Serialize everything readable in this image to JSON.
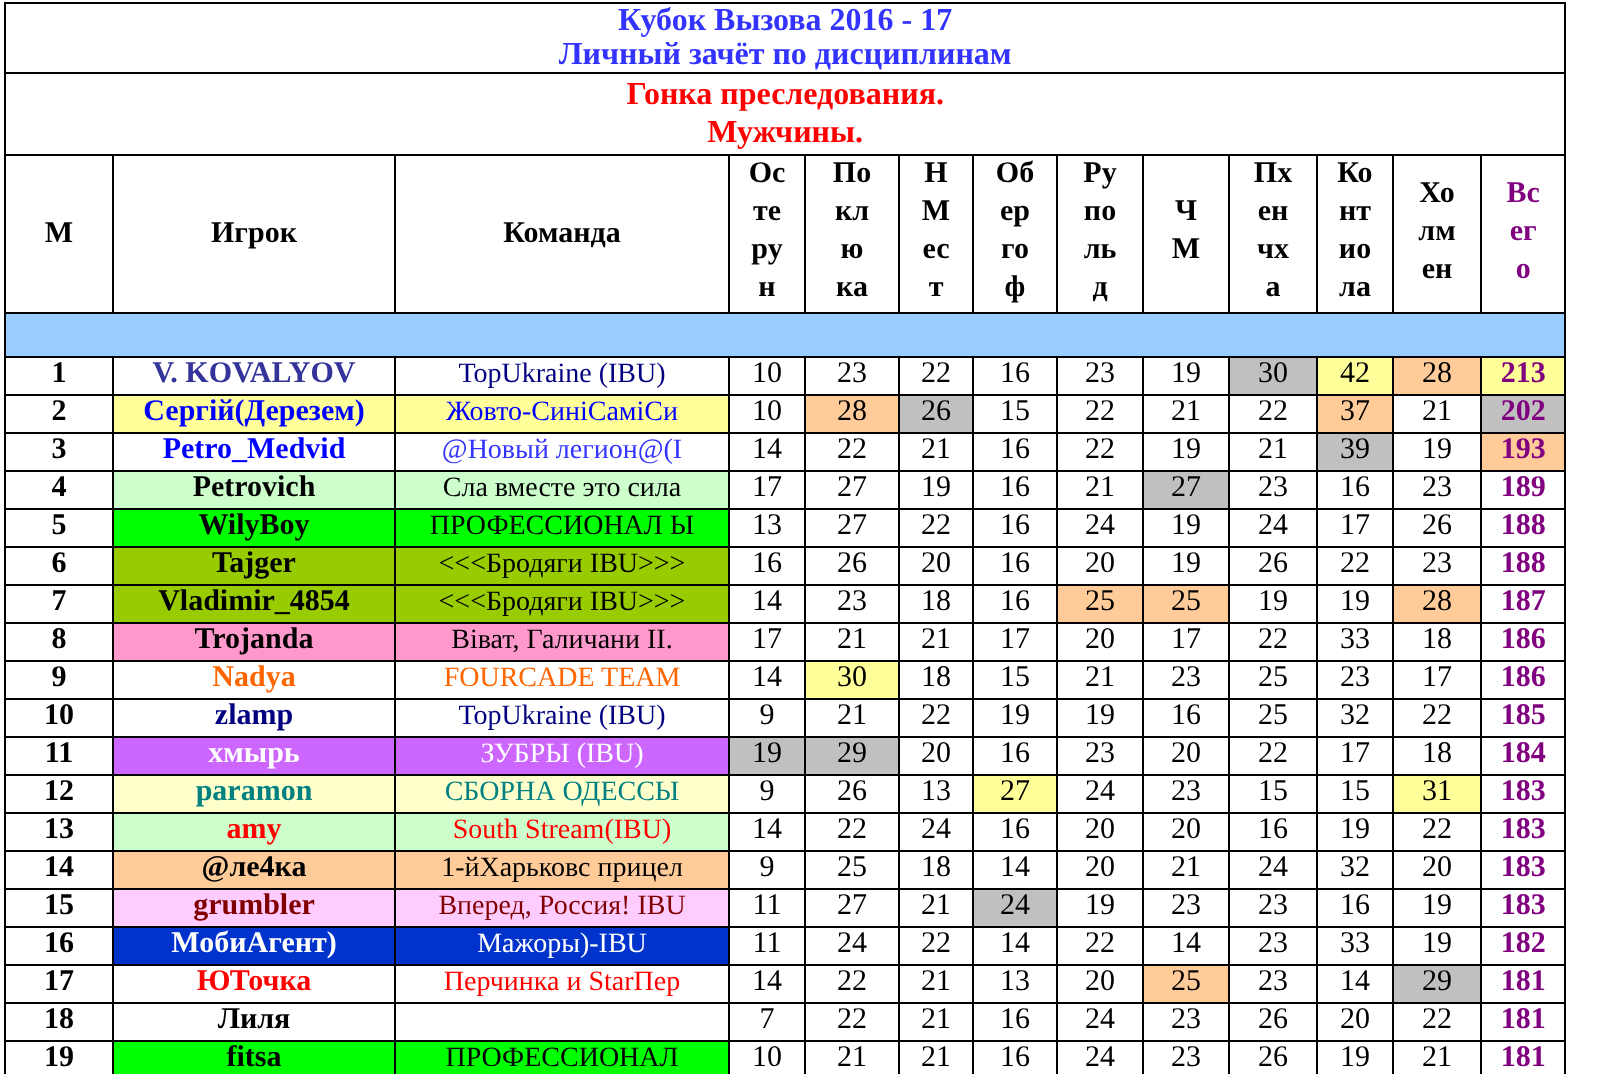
{
  "title": "Кубок Вызова 2016 - 17",
  "subtitle": "Личный зачёт по дисциплинам",
  "discipline": "Гонка преследования.",
  "category": "Мужчины.",
  "columns": [
    {
      "label": "М",
      "kind": "narrow"
    },
    {
      "label": "Игрок",
      "kind": "wide"
    },
    {
      "label": "Команда",
      "kind": "wide"
    },
    {
      "label": "Остерун",
      "kind": "score"
    },
    {
      "label": "Поклюка",
      "kind": "score"
    },
    {
      "label": "НМест",
      "kind": "score"
    },
    {
      "label": "Обергоф",
      "kind": "score"
    },
    {
      "label": "Рупольд",
      "kind": "score"
    },
    {
      "label": "ЧМ",
      "kind": "score"
    },
    {
      "label": "Пхенчха",
      "kind": "score"
    },
    {
      "label": "Контиола",
      "kind": "score"
    },
    {
      "label": "Холмен",
      "kind": "score"
    },
    {
      "label": "Всего",
      "kind": "total"
    }
  ],
  "rows": [
    {
      "place": "1",
      "player": {
        "name": "V. KOVALYOV",
        "color": "#333399"
      },
      "team": {
        "name": "TopUkraine (IBU)",
        "color": "#000080"
      },
      "scores": [
        {
          "value": "10"
        },
        {
          "value": "23"
        },
        {
          "value": "22"
        },
        {
          "value": "16"
        },
        {
          "value": "23"
        },
        {
          "value": "19"
        },
        {
          "value": "30",
          "color": "#c0c0c0"
        },
        {
          "value": "42",
          "color": "#ffff99"
        },
        {
          "value": "28",
          "color": "#ffcc99"
        }
      ],
      "total": {
        "value": "213",
        "color": "#ffff99"
      }
    },
    {
      "place": "2",
      "player": {
        "name": "Сергій(Дерезем)",
        "color": "#0000ff",
        "background": {
          "color": "#ffff99"
        }
      },
      "team": {
        "name": "Жовто-СиніСаміСи",
        "color": "#0000ff",
        "background": {
          "color": "#ffff99"
        }
      },
      "scores": [
        {
          "value": "10"
        },
        {
          "value": "28",
          "color": "#ffcc99"
        },
        {
          "value": "26",
          "color": "#c0c0c0"
        },
        {
          "value": "15"
        },
        {
          "value": "22"
        },
        {
          "value": "21"
        },
        {
          "value": "22"
        },
        {
          "value": "37",
          "color": "#ffcc99"
        },
        {
          "value": "21"
        }
      ],
      "total": {
        "value": "202",
        "color": "#c0c0c0"
      }
    },
    {
      "place": "3",
      "player": {
        "name": "Petro_Medvid",
        "color": "#0000ff"
      },
      "team": {
        "name": "@Новый легион@(I",
        "color": "#3333ff"
      },
      "scores": [
        {
          "value": "14"
        },
        {
          "value": "22"
        },
        {
          "value": "21"
        },
        {
          "value": "16"
        },
        {
          "value": "22"
        },
        {
          "value": "19"
        },
        {
          "value": "21"
        },
        {
          "value": "39",
          "color": "#c0c0c0"
        },
        {
          "value": "19"
        }
      ],
      "total": {
        "value": "193",
        "color": "#ffcc99"
      }
    },
    {
      "place": "4",
      "player": {
        "name": "Petrovich",
        "color": "#000000",
        "background": {
          "color": "#ccffcc"
        }
      },
      "team": {
        "name": "Сла вместе это сила",
        "color": "#000000",
        "background": {
          "color": "#ccffcc"
        }
      },
      "scores": [
        {
          "value": "17"
        },
        {
          "value": "27"
        },
        {
          "value": "19"
        },
        {
          "value": "16"
        },
        {
          "value": "21"
        },
        {
          "value": "27",
          "color": "#c0c0c0"
        },
        {
          "value": "23"
        },
        {
          "value": "16"
        },
        {
          "value": "23"
        }
      ],
      "total": {
        "value": "189"
      }
    },
    {
      "place": "5",
      "player": {
        "name": "WilyBoy",
        "color": "#000000",
        "background": {
          "color": "#00ff00"
        }
      },
      "team": {
        "name": "ПРОФЕССИОНАЛ Ы",
        "color": "#000000",
        "background": {
          "color": "#00ff00"
        }
      },
      "scores": [
        {
          "value": "13"
        },
        {
          "value": "27"
        },
        {
          "value": "22"
        },
        {
          "value": "16"
        },
        {
          "value": "24"
        },
        {
          "value": "19"
        },
        {
          "value": "24"
        },
        {
          "value": "17"
        },
        {
          "value": "26"
        }
      ],
      "total": {
        "value": "188"
      }
    },
    {
      "place": "6",
      "player": {
        "name": "Tajger",
        "color": "#000000",
        "background": {
          "color": "#99cc00"
        }
      },
      "team": {
        "name": "<<<Бродяги IBU>>>",
        "color": "#000000",
        "background": {
          "color": "#99cc00"
        }
      },
      "scores": [
        {
          "value": "16"
        },
        {
          "value": "26"
        },
        {
          "value": "20"
        },
        {
          "value": "16"
        },
        {
          "value": "20"
        },
        {
          "value": "19"
        },
        {
          "value": "26"
        },
        {
          "value": "22"
        },
        {
          "value": "23"
        }
      ],
      "total": {
        "value": "188"
      }
    },
    {
      "place": "7",
      "player": {
        "name": "Vladimir_4854",
        "color": "#000000",
        "background": {
          "color": "#99cc00"
        }
      },
      "team": {
        "name": "<<<Бродяги IBU>>>",
        "color": "#000000",
        "background": {
          "color": "#99cc00"
        }
      },
      "scores": [
        {
          "value": "14"
        },
        {
          "value": "23"
        },
        {
          "value": "18"
        },
        {
          "value": "16"
        },
        {
          "value": "25",
          "color": "#ffcc99"
        },
        {
          "value": "25",
          "color": "#ffcc99"
        },
        {
          "value": "19"
        },
        {
          "value": "19"
        },
        {
          "value": "28",
          "color": "#ffcc99"
        }
      ],
      "total": {
        "value": "187"
      }
    },
    {
      "place": "8",
      "player": {
        "name": "Trojanda",
        "color": "#000000",
        "background": {
          "color": "#ff99cc"
        }
      },
      "team": {
        "name": "Віват, Галичани II.",
        "color": "#000000",
        "background": {
          "color": "#ff99cc"
        }
      },
      "scores": [
        {
          "value": "17"
        },
        {
          "value": "21"
        },
        {
          "value": "21"
        },
        {
          "value": "17"
        },
        {
          "value": "20"
        },
        {
          "value": "17"
        },
        {
          "value": "22"
        },
        {
          "value": "33"
        },
        {
          "value": "18"
        }
      ],
      "total": {
        "value": "186"
      }
    },
    {
      "place": "9",
      "player": {
        "name": "Nadya",
        "color": "#ff6600"
      },
      "team": {
        "name": "FOURCADE  TEAM",
        "color": "#ff6600"
      },
      "scores": [
        {
          "value": "14"
        },
        {
          "value": "30",
          "color": "#ffff99"
        },
        {
          "value": "18"
        },
        {
          "value": "15"
        },
        {
          "value": "21"
        },
        {
          "value": "23"
        },
        {
          "value": "25"
        },
        {
          "value": "23"
        },
        {
          "value": "17"
        }
      ],
      "total": {
        "value": "186"
      }
    },
    {
      "place": "10",
      "player": {
        "name": "zlamp",
        "color": "#000080"
      },
      "team": {
        "name": "TopUkraine (IBU)",
        "color": "#000080"
      },
      "scores": [
        {
          "value": "9"
        },
        {
          "value": "21"
        },
        {
          "value": "22"
        },
        {
          "value": "19"
        },
        {
          "value": "19"
        },
        {
          "value": "16"
        },
        {
          "value": "25"
        },
        {
          "value": "32"
        },
        {
          "value": "22"
        }
      ],
      "total": {
        "value": "185"
      }
    },
    {
      "place": "11",
      "player": {
        "name": "хмырь",
        "color": "#ffffff",
        "background": {
          "color": "#cc66ff"
        }
      },
      "team": {
        "name": "ЗУБРЫ (IBU)",
        "color": "#ffffff",
        "background": {
          "color": "#cc66ff"
        }
      },
      "scores": [
        {
          "value": "19",
          "color": "#c0c0c0"
        },
        {
          "value": "29",
          "color": "#c0c0c0"
        },
        {
          "value": "20"
        },
        {
          "value": "16"
        },
        {
          "value": "23"
        },
        {
          "value": "20"
        },
        {
          "value": "22"
        },
        {
          "value": "17"
        },
        {
          "value": "18"
        }
      ],
      "total": {
        "value": "184"
      }
    },
    {
      "place": "12",
      "player": {
        "name": "paramon",
        "color": "#008080",
        "background": {
          "color": "#ffffcc"
        }
      },
      "team": {
        "name": "СБОРНА ОДЕССЫ",
        "color": "#008080",
        "background": {
          "color": "#ffffcc"
        }
      },
      "scores": [
        {
          "value": "9"
        },
        {
          "value": "26"
        },
        {
          "value": "13"
        },
        {
          "value": "27",
          "color": "#ffff99"
        },
        {
          "value": "24"
        },
        {
          "value": "23"
        },
        {
          "value": "15"
        },
        {
          "value": "15"
        },
        {
          "value": "31",
          "color": "#ffff99"
        }
      ],
      "total": {
        "value": "183"
      }
    },
    {
      "place": "13",
      "player": {
        "name": "amy",
        "color": "#ff0000",
        "background": {
          "color": "#ccffcc"
        }
      },
      "team": {
        "name": "South Stream(IBU)",
        "color": "#ff0000",
        "background": {
          "color": "#ccffcc"
        }
      },
      "scores": [
        {
          "value": "14"
        },
        {
          "value": "22"
        },
        {
          "value": "24"
        },
        {
          "value": "16"
        },
        {
          "value": "20"
        },
        {
          "value": "20"
        },
        {
          "value": "16"
        },
        {
          "value": "19"
        },
        {
          "value": "22"
        }
      ],
      "total": {
        "value": "183"
      }
    },
    {
      "place": "14",
      "player": {
        "name": "@ле4ка",
        "color": "#000000",
        "background": {
          "color": "#ffcc99"
        }
      },
      "team": {
        "name": "1-йХарьковс прицел",
        "color": "#000000",
        "background": {
          "color": "#ffcc99"
        }
      },
      "scores": [
        {
          "value": "9"
        },
        {
          "value": "25"
        },
        {
          "value": "18"
        },
        {
          "value": "14"
        },
        {
          "value": "20"
        },
        {
          "value": "21"
        },
        {
          "value": "24"
        },
        {
          "value": "32"
        },
        {
          "value": "20"
        }
      ],
      "total": {
        "value": "183"
      }
    },
    {
      "place": "15",
      "player": {
        "name": "grumbler",
        "color": "#800000",
        "background": {
          "color": "#ffccff"
        }
      },
      "team": {
        "name": "Вперед, Россия! IBU",
        "color": "#800000",
        "background": {
          "color": "#ffccff"
        }
      },
      "scores": [
        {
          "value": "11"
        },
        {
          "value": "27"
        },
        {
          "value": "21"
        },
        {
          "value": "24",
          "color": "#c0c0c0"
        },
        {
          "value": "19"
        },
        {
          "value": "23"
        },
        {
          "value": "23"
        },
        {
          "value": "16"
        },
        {
          "value": "19"
        }
      ],
      "total": {
        "value": "183"
      }
    },
    {
      "place": "16",
      "player": {
        "name": "МобиАгент)",
        "color": "#ffffff",
        "background": {
          "color": "#0033cc"
        }
      },
      "team": {
        "name": "Мажоры)-IBU",
        "color": "#ffffff",
        "background": {
          "color": "#0033cc"
        }
      },
      "scores": [
        {
          "value": "11"
        },
        {
          "value": "24"
        },
        {
          "value": "22"
        },
        {
          "value": "14"
        },
        {
          "value": "22"
        },
        {
          "value": "14"
        },
        {
          "value": "23"
        },
        {
          "value": "33"
        },
        {
          "value": "19"
        }
      ],
      "total": {
        "value": "182"
      }
    },
    {
      "place": "17",
      "player": {
        "name": "ЮТочка",
        "color": "#ff0000"
      },
      "team": {
        "name": "Перчинка и StarПер",
        "color": "#ff0000"
      },
      "scores": [
        {
          "value": "14"
        },
        {
          "value": "22"
        },
        {
          "value": "21"
        },
        {
          "value": "13"
        },
        {
          "value": "20"
        },
        {
          "value": "25",
          "color": "#ffcc99"
        },
        {
          "value": "23"
        },
        {
          "value": "14"
        },
        {
          "value": "29",
          "color": "#c0c0c0"
        }
      ],
      "total": {
        "value": "181"
      }
    },
    {
      "place": "18",
      "player": {
        "name": "Лиля",
        "color": "#000000"
      },
      "scores": [
        {
          "value": "7"
        },
        {
          "value": "22"
        },
        {
          "value": "21"
        },
        {
          "value": "16"
        },
        {
          "value": "24"
        },
        {
          "value": "23"
        },
        {
          "value": "26"
        },
        {
          "value": "20"
        },
        {
          "value": "22"
        }
      ],
      "total": {
        "value": "181"
      }
    },
    {
      "place": "19",
      "player": {
        "name": "fitsa",
        "color": "#000000",
        "background": {
          "color": "#00ff00"
        }
      },
      "team": {
        "name": "ПРОФЕССИОНАЛ",
        "color": "#000000",
        "background": {
          "color": "#00ff00"
        }
      },
      "scores": [
        {
          "value": "10"
        },
        {
          "value": "21"
        },
        {
          "value": "21"
        },
        {
          "value": "16"
        },
        {
          "value": "24"
        },
        {
          "value": "23"
        },
        {
          "value": "26"
        },
        {
          "value": "19"
        },
        {
          "value": "21"
        }
      ],
      "total": {
        "value": "181"
      }
    }
  ]
}
